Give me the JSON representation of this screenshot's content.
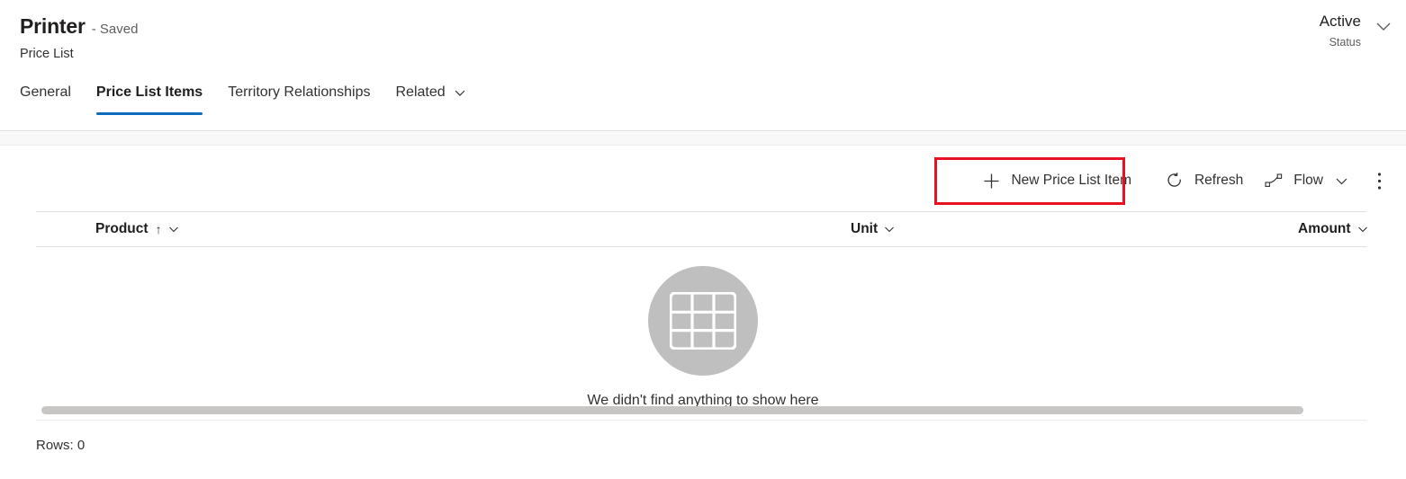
{
  "header": {
    "record_name": "Printer",
    "saved_state": "- Saved",
    "entity_type": "Price List",
    "status_value": "Active",
    "status_label": "Status",
    "status_chevron_icon": "chevron-down-icon"
  },
  "tabs": [
    {
      "label": "General",
      "active": false
    },
    {
      "label": "Price List Items",
      "active": true
    },
    {
      "label": "Territory Relationships",
      "active": false
    },
    {
      "label": "Related",
      "active": false,
      "chevron_icon": "chevron-down-icon"
    }
  ],
  "commandbar": {
    "new_item_label": "New Price List Item",
    "new_item_icon": "plus-icon",
    "refresh_label": "Refresh",
    "refresh_icon": "refresh-icon",
    "flow_label": "Flow",
    "flow_icon": "flow-icon",
    "flow_chevron_icon": "chevron-down-icon",
    "overflow_icon": "more-vertical-icon",
    "highlight_color": "#e81123"
  },
  "grid": {
    "columns": [
      {
        "label": "Product",
        "sort_icon": "sort-ascending-arrow-icon",
        "menu_icon": "chevron-down-icon"
      },
      {
        "label": "Unit",
        "menu_icon": "chevron-down-icon"
      },
      {
        "label": "Amount",
        "menu_icon": "chevron-down-icon"
      }
    ],
    "rows": [],
    "empty_message": "We didn't find anything to show here",
    "empty_icon": "table-grid-icon",
    "rows_count_label": "Rows: 0"
  },
  "colors": {
    "accent": "#0f6cbd",
    "text": "#323130",
    "muted": "#605e5c",
    "divider": "#e1dfdd",
    "empty_icon_bg": "#bfbfbf"
  }
}
